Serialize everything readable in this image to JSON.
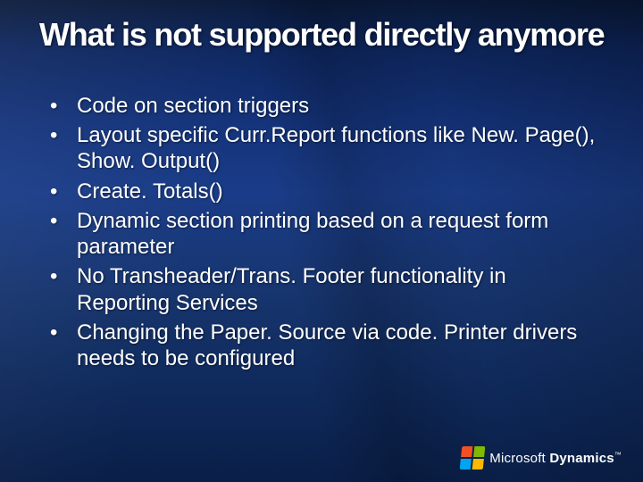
{
  "slide": {
    "title": "What is not supported directly anymore",
    "bullets": [
      "Code on section triggers",
      "Layout specific Curr.Report functions like New. Page(), Show. Output()",
      "Create. Totals()",
      "Dynamic section printing based on a request form parameter",
      "No Transheader/Trans. Footer functionality in Reporting Services",
      "Changing the Paper. Source via code. Printer drivers needs to be configured"
    ]
  },
  "footer": {
    "brand_primary": "Microsoft",
    "brand_secondary": "Dynamics",
    "trademark": "™"
  }
}
